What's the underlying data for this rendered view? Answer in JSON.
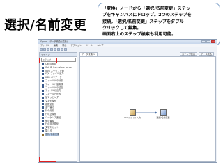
{
  "slide_title": "選択/名前変更",
  "callout": {
    "lines": [
      "「変換」ノードから「選択/名前変更」ステッ",
      "プをキャンバスにドロップ。2つのステップを",
      "接続。「選択/名前変更」ステップをダブル",
      "クリックして編集。",
      "画面右上のステップ検索も利用可能。"
    ]
  },
  "window": {
    "title": "Spoon - データ統合 (変換)",
    "menu": [
      "ファイル",
      "編集",
      "表示",
      "アクション",
      "ツール",
      "ヘルプ"
    ]
  },
  "left_panel": {
    "header": "デザイン",
    "search_placeholder": "ステップ",
    "steps": [
      {
        "label": "Calculator",
        "selected": false
      },
      {
        "label": "Get ID from slave server",
        "selected": false
      },
      {
        "label": "Java スクリプト値",
        "selected": false
      },
      {
        "label": "SQL ファイル出力",
        "selected": false
      },
      {
        "label": "XSD バリデーター",
        "selected": false
      },
      {
        "label": "フィールドの分割",
        "selected": false
      },
      {
        "label": "フィールド値置換",
        "selected": false
      },
      {
        "label": "フィールドの結合",
        "selected": false
      },
      {
        "label": "ファイルに出力",
        "selected": false
      },
      {
        "label": "フィールド比較",
        "selected": false
      },
      {
        "label": "値マッピング",
        "selected": false
      },
      {
        "label": "文字列操作",
        "selected": false
      },
      {
        "label": "定数追加",
        "selected": false
      },
      {
        "label": "並べ替え",
        "selected": false
      },
      {
        "label": "行の分割",
        "selected": false
      },
      {
        "label": "行の正規化",
        "selected": false
      },
      {
        "label": "シーケンス追加",
        "selected": false
      },
      {
        "label": "値の置換",
        "selected": false
      },
      {
        "label": "行の非正規化",
        "selected": false
      },
      {
        "label": "文字列カット",
        "selected": false
      },
      {
        "label": "閉じる",
        "selected": false
      },
      {
        "label": "選択/名前変更",
        "selected": true
      }
    ]
  },
  "canvas": {
    "tab_label": "データ変換 1",
    "mode_buttons": [
      "ステップ検索",
      "データ統合"
    ],
    "nodes": {
      "source": "CSVファイル入力",
      "target": "選択/名前変更"
    }
  },
  "colors": {
    "highlight": "#e02020",
    "callout_border": "#7fa0c8"
  }
}
